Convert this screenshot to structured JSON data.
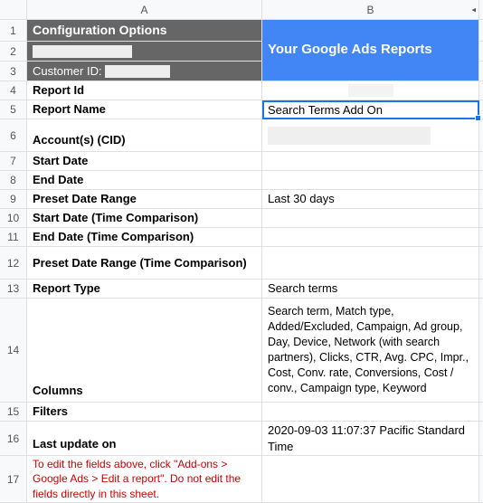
{
  "columns": {
    "A": "A",
    "B": "B"
  },
  "rowNumbers": [
    "1",
    "2",
    "3",
    "4",
    "5",
    "6",
    "7",
    "8",
    "9",
    "10",
    "11",
    "12",
    "13",
    "14",
    "15",
    "16",
    "17"
  ],
  "header": {
    "configTitle": "Configuration Options",
    "customerIdLabel": "Customer ID:",
    "reportsTitle": "Your Google Ads Reports"
  },
  "labels": {
    "reportId": "Report Id",
    "reportName": "Report Name",
    "accounts": "Account(s) (CID)",
    "startDate": "Start Date",
    "endDate": "End Date",
    "presetDateRange": "Preset Date Range",
    "startDateCmp": "Start Date (Time Comparison)",
    "endDateCmp": "End Date (Time Comparison)",
    "presetDateRangeCmp": "Preset Date Range (Time Comparison)",
    "reportType": "Report Type",
    "columns": "Columns",
    "filters": "Filters",
    "lastUpdate": "Last update on"
  },
  "values": {
    "reportId": "",
    "reportName": "Search Terms Add On",
    "accounts": "",
    "startDate": "",
    "endDate": "",
    "presetDateRange": "Last 30 days",
    "startDateCmp": "",
    "endDateCmp": "",
    "presetDateRangeCmp": "",
    "reportType": "Search terms",
    "columns": "Search term, Match type, Added/Excluded, Campaign, Ad group, Day, Device, Network (with search partners), Clicks, CTR, Avg. CPC, Impr., Cost, Conv. rate, Conversions, Cost / conv., Campaign type, Keyword",
    "filters": "",
    "lastUpdate": "2020-09-03 11:07:37 Pacific Standard Time"
  },
  "note": "To edit the fields above, click \"Add-ons > Google Ads > Edit a report\". Do not edit the fields directly in this sheet.",
  "chart_data": null
}
